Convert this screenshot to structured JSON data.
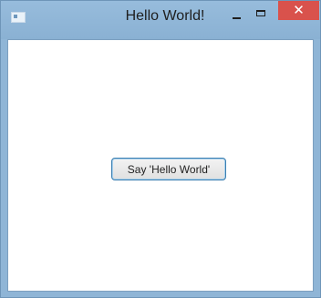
{
  "window": {
    "title": "Hello World!",
    "controls": {
      "minimize_icon": "minimize-icon",
      "maximize_icon": "maximize-icon",
      "close_glyph": "✕",
      "close_icon": "close-icon"
    },
    "app_icon": "app-icon"
  },
  "main": {
    "button_label": "Say 'Hello World'"
  },
  "colors": {
    "titlebar": "#8fb5d6",
    "close_button": "#d9524c",
    "client_background": "#ffffff",
    "button_border": "#3c7fb1"
  }
}
